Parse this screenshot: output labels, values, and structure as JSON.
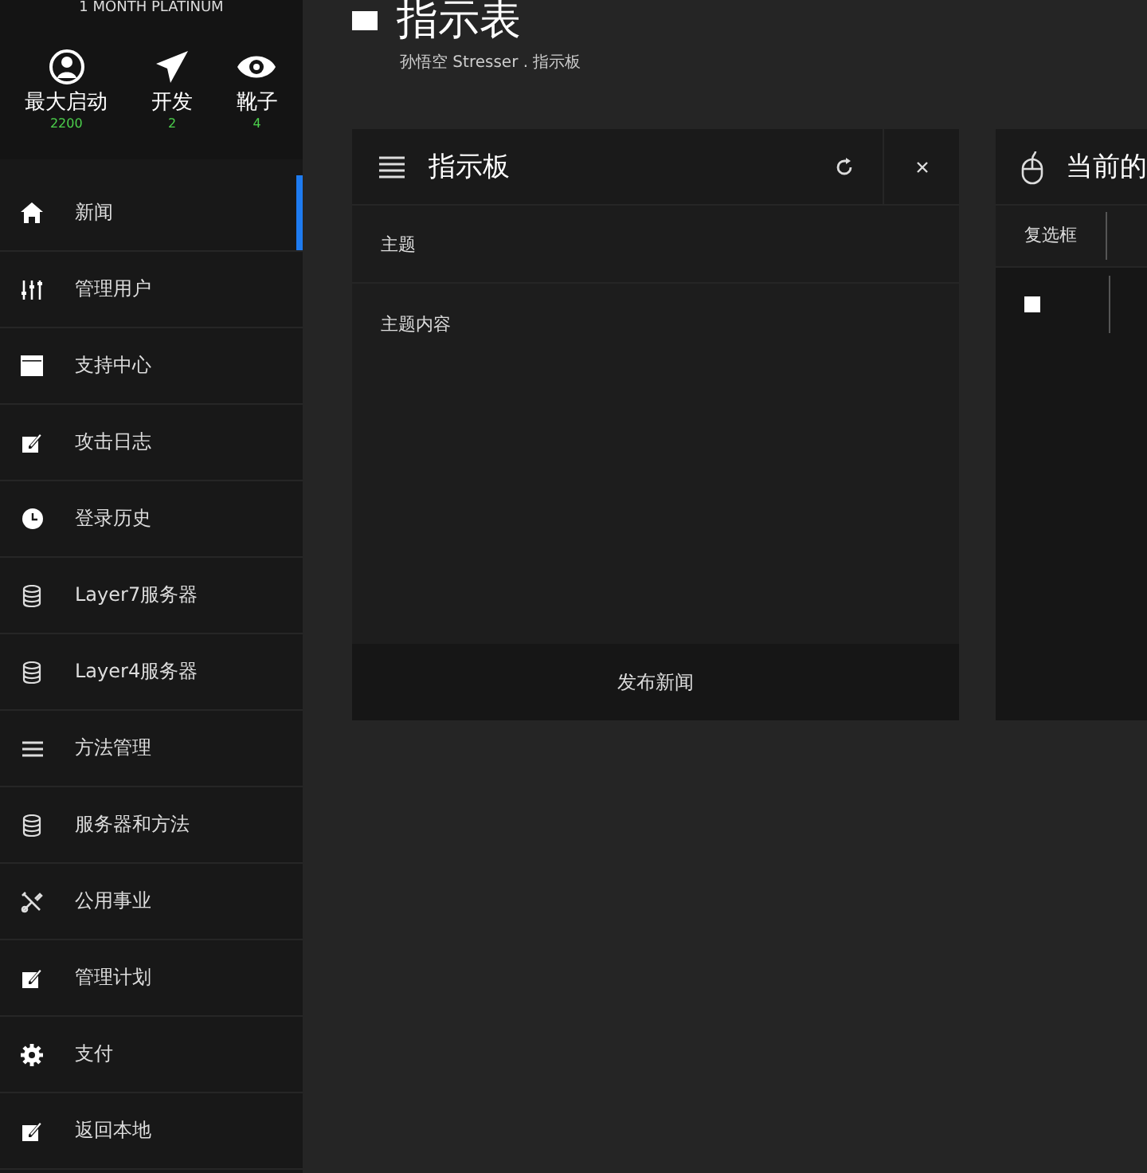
{
  "profile": {
    "plan": "1 MONTH PLATINUM",
    "stats": [
      {
        "kind": "user",
        "label": "最大启动",
        "value": "2200"
      },
      {
        "kind": "send",
        "label": "开发",
        "value": "2"
      },
      {
        "kind": "eye",
        "label": "靴子",
        "value": "4"
      }
    ]
  },
  "sidebar": {
    "items": [
      {
        "label": "新闻",
        "selected": true
      },
      {
        "label": "管理用户",
        "selected": false
      },
      {
        "label": "支持中心",
        "selected": false
      },
      {
        "label": "攻击日志",
        "selected": false
      },
      {
        "label": "登录历史",
        "selected": false
      },
      {
        "label": "Layer7服务器",
        "selected": false
      },
      {
        "label": "Layer4服务器",
        "selected": false
      },
      {
        "label": "方法管理",
        "selected": false
      },
      {
        "label": "服务器和方法",
        "selected": false
      },
      {
        "label": "公用事业",
        "selected": false
      },
      {
        "label": "管理计划",
        "selected": false
      },
      {
        "label": "支付",
        "selected": false
      },
      {
        "label": "返回本地",
        "selected": false
      }
    ]
  },
  "page": {
    "title": "指示表",
    "breadcrumb": "孙悟空 Stresser . 指示板"
  },
  "news_panel": {
    "title": "指示板",
    "subject": {
      "placeholder": "主题"
    },
    "content": {
      "placeholder": "主题内容"
    },
    "submit": "发布新闻"
  },
  "current_panel": {
    "title": "当前的",
    "columns": [
      "复选框"
    ],
    "rows": [
      {
        "checked": false
      }
    ]
  }
}
